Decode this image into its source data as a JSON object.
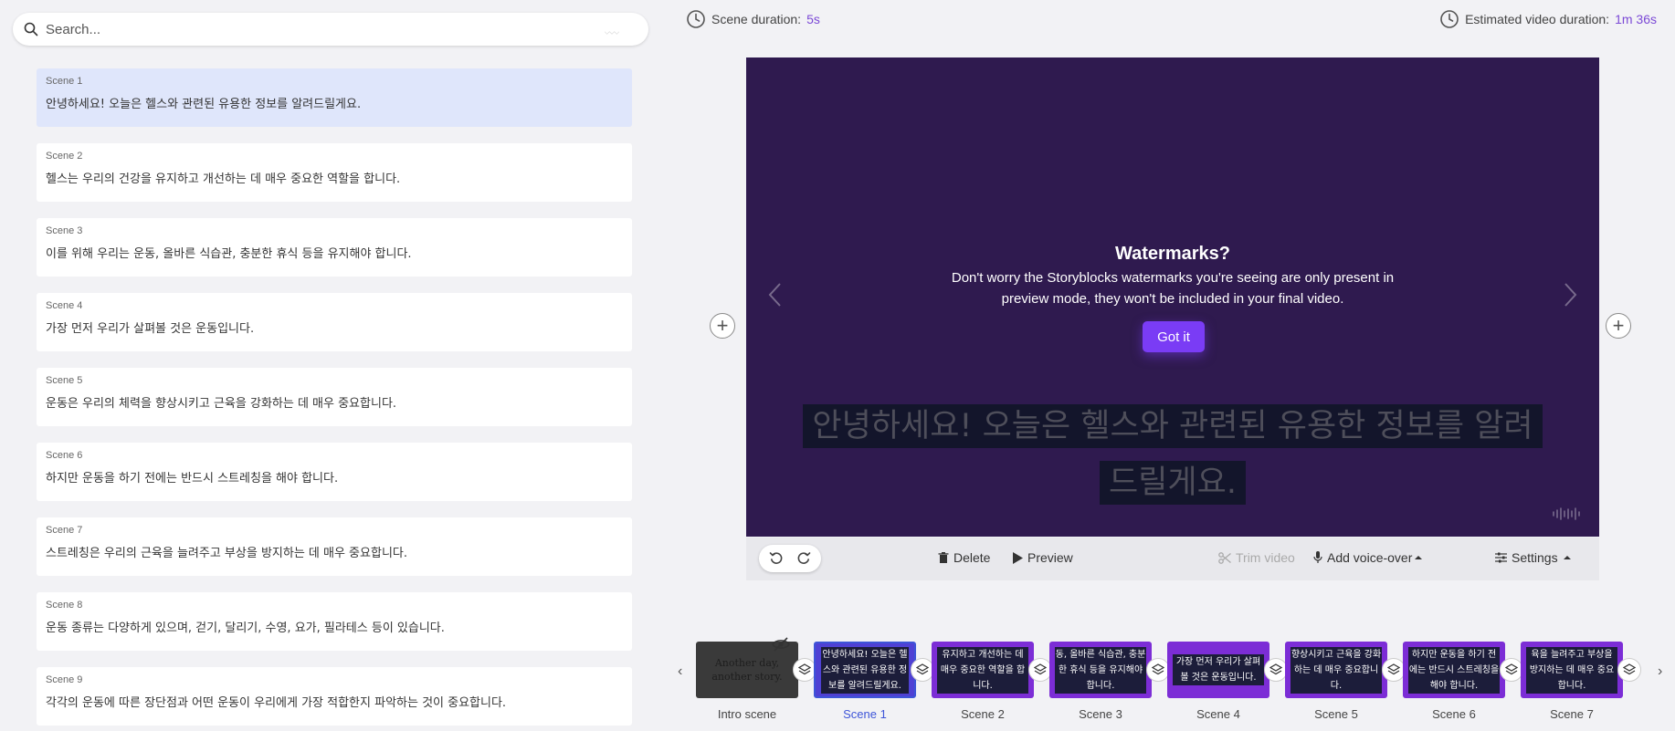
{
  "search": {
    "placeholder": "Search..."
  },
  "scenes": [
    {
      "label": "Scene 1",
      "text": "안녕하세요! 오늘은 헬스와 관련된 유용한 정보를 알려드릴게요."
    },
    {
      "label": "Scene 2",
      "text": "헬스는 우리의 건강을 유지하고 개선하는 데 매우 중요한 역할을 합니다."
    },
    {
      "label": "Scene 3",
      "text": "이를 위해 우리는 운동, 올바른 식습관, 충분한 휴식 등을 유지해야 합니다."
    },
    {
      "label": "Scene 4",
      "text": "가장 먼저 우리가 살펴볼 것은 운동입니다."
    },
    {
      "label": "Scene 5",
      "text": "운동은 우리의 체력을 향상시키고 근육을 강화하는 데 매우 중요합니다."
    },
    {
      "label": "Scene 6",
      "text": "하지만 운동을 하기 전에는 반드시 스트레칭을 해야 합니다."
    },
    {
      "label": "Scene 7",
      "text": "스트레칭은 우리의 근육을 늘려주고 부상을 방지하는 데 매우 중요합니다."
    },
    {
      "label": "Scene 8",
      "text": "운동 종류는 다양하게 있으며, 걷기, 달리기, 수영, 요가, 필라테스 등이 있습니다."
    },
    {
      "label": "Scene 9",
      "text": "각각의 운동에 따른 장단점과 어떤 운동이 우리에게 가장 적합한지 파악하는 것이 중요합니다."
    }
  ],
  "header": {
    "scene_duration_label": "Scene duration:",
    "scene_duration_value": "5s",
    "video_duration_label": "Estimated video duration:",
    "video_duration_value": "1m 36s"
  },
  "preview": {
    "watermark_title": "Watermarks?",
    "watermark_text": "Don't worry the Storyblocks watermarks you're seeing are only present in preview mode, they won't be included in your final video.",
    "got_it": "Got it",
    "caption": "안녕하세요! 오늘은 헬스와 관련된 유용한 정보를 알려드릴게요."
  },
  "toolbar": {
    "delete": "Delete",
    "preview": "Preview",
    "trim": "Trim video",
    "voiceover": "Add voice-over",
    "settings": "Settings"
  },
  "timeline": {
    "intro_label": "Intro scene",
    "intro_text": "Another day, another story.",
    "thumbs": [
      {
        "label": "Scene 1",
        "text": "안녕하세요! 오늘은 헬스와 관련된 유용한 정보를 알려드릴게요."
      },
      {
        "label": "Scene 2",
        "text": "유지하고 개선하는 데 매우 중요한 역할을 합니다."
      },
      {
        "label": "Scene 3",
        "text": "동, 올바른 식습관, 충분한 휴식 등을 유지해야 합니다."
      },
      {
        "label": "Scene 4",
        "text": "가장 먼저 우리가 살펴볼 것은 운동입니다."
      },
      {
        "label": "Scene 5",
        "text": "향상시키고 근육을 강화하는 데 매우 중요합니다."
      },
      {
        "label": "Scene 6",
        "text": "하지만 운동을 하기 전에는 반드시 스트레칭을 해야 합니다."
      },
      {
        "label": "Scene 7",
        "text": "육을 늘려주고 부상을 방지하는 데 매우 중요합니다."
      }
    ]
  },
  "colors": {
    "accent": "#7a3cf5",
    "duration_value": "#7c4ad6",
    "preview_bg": "#2f1a4f",
    "active_scene": "#dfe6fb",
    "active_thumb_border": "#3e55d8"
  }
}
